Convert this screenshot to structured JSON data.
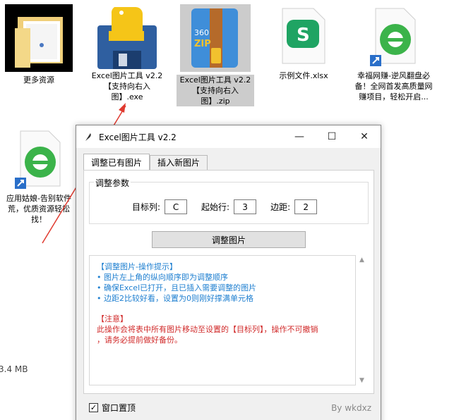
{
  "desktop": {
    "icons": [
      {
        "label": "更多资源",
        "type": "folder-icon"
      },
      {
        "label": "Excel图片工具 v2.2 【支持向右入图】.exe",
        "type": "python-exe-icon"
      },
      {
        "label": "Excel图片工具 v2.2 【支持向右入图】.zip",
        "type": "zip-icon"
      },
      {
        "label": "示例文件.xlsx",
        "type": "spreadsheet-icon"
      },
      {
        "label": "幸福网赚-逆风翻盘必备！全网首发高质量网赚项目，轻松开启...",
        "type": "ie-shortcut-icon"
      },
      {
        "label": "应用姑娘-告别软件荒，优质资源轻松找！",
        "type": "ie-shortcut-icon"
      }
    ],
    "status": "3.4 MB",
    "zip_badge": "360\nZIP"
  },
  "window": {
    "title": "Excel图片工具 v2.2",
    "minimize": "—",
    "maximize": "☐",
    "close": "✕",
    "tabs": [
      {
        "label": "调整已有图片",
        "active": true
      },
      {
        "label": "插入新图片",
        "active": false
      }
    ],
    "group_title": "调整参数",
    "params": {
      "target_col_label": "目标列:",
      "target_col_value": "C",
      "start_row_label": "起始行:",
      "start_row_value": "3",
      "margin_label": "边距:",
      "margin_value": "2"
    },
    "action_button": "调整图片",
    "tips": {
      "heading": "【调整图片-操作提示】",
      "lines": [
        "• 图片左上角的纵向顺序即为调整顺序",
        "• 确保Excel已打开，且已插入需要调整的图片",
        "• 边距2比较好看，设置为0则刚好撑满单元格"
      ],
      "warning_heading": "【注意】",
      "warning_lines": [
        "此操作会将表中所有图片移动至设置的【目标列】，操作不可撤销",
        "，请务必提前做好备份。"
      ]
    },
    "footer": {
      "topmost_label": "窗口置顶",
      "topmost_checked": "✓",
      "credit": "By wkdxz"
    }
  },
  "colors": {
    "tip_blue": "#1e7fd0",
    "tip_red": "#d12b2b",
    "annotation_arrow": "#e03a2f"
  }
}
